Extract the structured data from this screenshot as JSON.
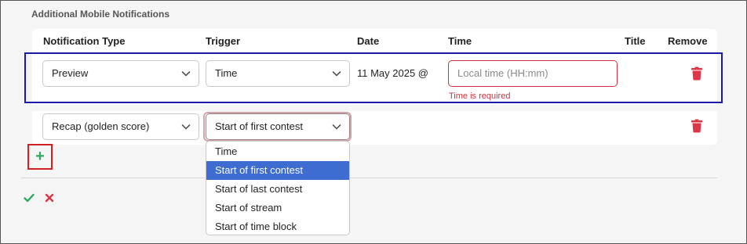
{
  "section": {
    "title": "Additional Mobile Notifications"
  },
  "headers": {
    "notification_type": "Notification Type",
    "trigger": "Trigger",
    "date": "Date",
    "time": "Time",
    "title": "Title",
    "remove": "Remove"
  },
  "rows": [
    {
      "notification_type": "Preview",
      "trigger": "Time",
      "date": "11 May 2025 @",
      "time_placeholder": "Local time (HH:mm)",
      "time_error": "Time is required"
    },
    {
      "notification_type": "Recap (golden score)",
      "trigger": "Start of first contest"
    }
  ],
  "trigger_dropdown": {
    "options": [
      "Time",
      "Start of first contest",
      "Start of last contest",
      "Start of stream",
      "Start of time block"
    ],
    "selected": "Start of first contest"
  },
  "colors": {
    "accent_blue": "#3e6cd1",
    "error_red": "#c9333f",
    "trash_red": "#dc3545",
    "add_green": "#2eaa5c",
    "highlight_blue": "#1a1aa6",
    "highlight_red": "#d31f1f"
  },
  "icons": {
    "add": "plus-icon",
    "remove": "trash-icon",
    "confirm": "check-icon",
    "cancel": "x-icon",
    "select_caret": "chevron-down-icon"
  }
}
